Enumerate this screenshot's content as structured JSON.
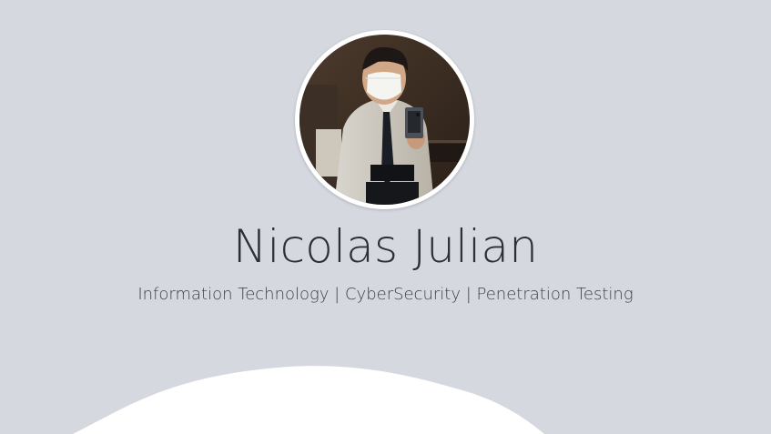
{
  "profile": {
    "name": "Nicolas Julian",
    "tagline": "Information Technology | CyberSecurity | Penetration Testing"
  },
  "colors": {
    "background": "#d5d8df",
    "wave": "#ffffff",
    "name_text": "#2b2f36",
    "tagline_text": "#3b4048"
  }
}
